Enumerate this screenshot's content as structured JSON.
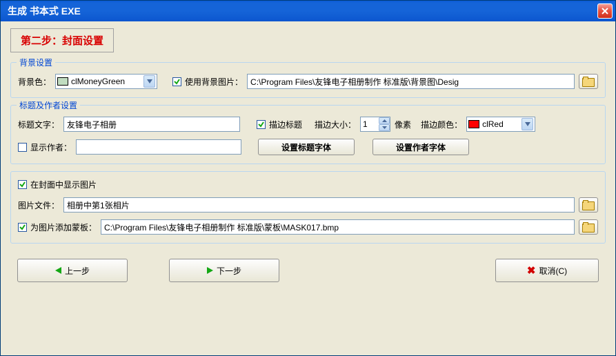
{
  "window": {
    "title": "生成 书本式 EXE"
  },
  "step": {
    "label": "第二步：封面设置"
  },
  "bg": {
    "legend": "背景设置",
    "color_label": "背景色：",
    "color_name": "clMoneyGreen",
    "color_hex": "#c0dcc0",
    "use_image_label": "使用背景图片：",
    "image_path": "C:\\Program Files\\友锋电子相册制作 标准版\\背景图\\Desig"
  },
  "titleAuthor": {
    "legend": "标题及作者设置",
    "title_label": "标题文字：",
    "title_value": "友锋电子相册",
    "outline_label": "描边标题",
    "outline_size_label": "描边大小：",
    "outline_size": "1",
    "px_label": "像素",
    "outline_color_label": "描边颜色：",
    "outline_color_name": "clRed",
    "outline_color_hex": "#ff0000",
    "show_author_label": "显示作者：",
    "author_value": "",
    "btn_title_font": "设置标题字体",
    "btn_author_font": "设置作者字体"
  },
  "cover": {
    "show_image_label": "在封面中显示图片",
    "file_label": "图片文件：",
    "file_value": "相册中第1张相片",
    "mask_label": "为图片添加蒙板：",
    "mask_value": "C:\\Program Files\\友锋电子相册制作 标准版\\蒙板\\MASK017.bmp"
  },
  "nav": {
    "prev": "上一步",
    "next": "下一步",
    "cancel": "取消(C)"
  }
}
